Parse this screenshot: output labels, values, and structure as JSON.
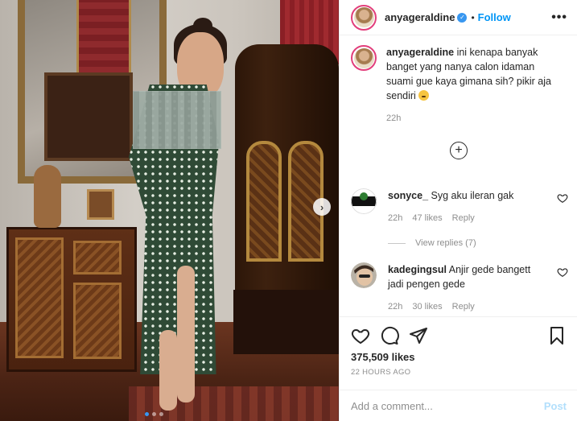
{
  "post": {
    "author": "anyageraldine",
    "follow_label": "Follow",
    "separator": "•",
    "more_label": "•••"
  },
  "caption": {
    "author": "anyageraldine",
    "text": "ini kenapa banyak banget yang nanya calon idaman suami gue kaya gimana sih? pikir aja sendiri",
    "emoji": "sad-face-emoji",
    "time": "22h"
  },
  "load_more": {
    "icon": "plus-circle-icon"
  },
  "comments": [
    {
      "author": "sonyce_",
      "text": "Syg aku ileran gak",
      "time": "22h",
      "likes": "47 likes",
      "reply_label": "Reply"
    },
    {
      "author": "kadegingsul",
      "text": "Anjir gede bangett jadi pengen gede",
      "time": "22h",
      "likes": "30 likes",
      "reply_label": "Reply"
    }
  ],
  "view_replies": "View replies (7)",
  "actions": {
    "likes": "375,509 likes",
    "date": "22 HOURS AGO"
  },
  "composer": {
    "placeholder": "Add a comment...",
    "post_label": "Post"
  },
  "carousel": {
    "slides": 3,
    "active": 1
  },
  "colors": {
    "accent": "#0095f6",
    "verified": "#3897f0",
    "post_disabled": "#b2dffc",
    "muted": "#8e8e8e"
  }
}
